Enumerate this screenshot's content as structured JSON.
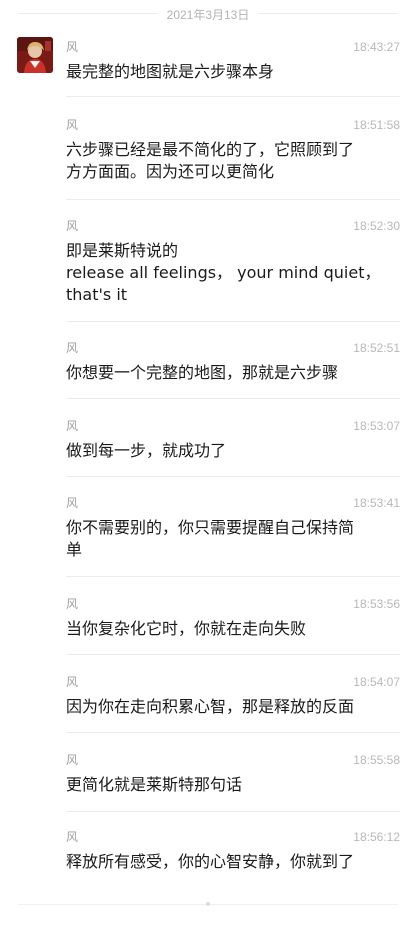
{
  "date_header": "2021年3月13日",
  "avatar": {
    "icon": "profile-photo-avatar"
  },
  "messages": [
    {
      "sender": "风",
      "time": "18:43:27",
      "text": "最完整的地图就是六步骤本身"
    },
    {
      "sender": "风",
      "time": "18:51:58",
      "text": "六步骤已经是最不简化的了，它照顾到了\n方方面面。因为还可以更简化"
    },
    {
      "sender": "风",
      "time": "18:52:30",
      "text": "即是莱斯特说的\nrelease all feelings， your mind quiet，\nthat's it"
    },
    {
      "sender": "风",
      "time": "18:52:51",
      "text": "你想要一个完整的地图，那就是六步骤"
    },
    {
      "sender": "风",
      "time": "18:53:07",
      "text": "做到每一步，就成功了"
    },
    {
      "sender": "风",
      "time": "18:53:41",
      "text": "你不需要别的，你只需要提醒自己保持简\n单"
    },
    {
      "sender": "风",
      "time": "18:53:56",
      "text": "当你复杂化它时，你就在走向失败"
    },
    {
      "sender": "风",
      "time": "18:54:07",
      "text": "因为你在走向积累心智，那是释放的反面"
    },
    {
      "sender": "风",
      "time": "18:55:58",
      "text": "更简化就是莱斯特那句话"
    },
    {
      "sender": "风",
      "time": "18:56:12",
      "text": "释放所有感受，你的心智安静，你就到了"
    }
  ]
}
